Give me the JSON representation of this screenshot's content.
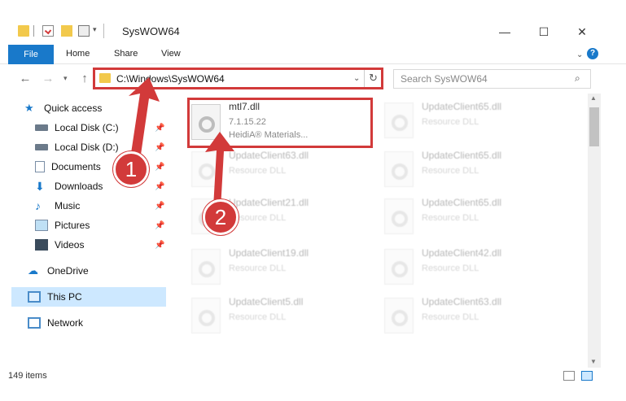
{
  "window": {
    "title": "SysWOW64",
    "minimize": "—",
    "maximize": "☐",
    "close": "✕"
  },
  "ribbon": {
    "tabs": [
      "File",
      "Home",
      "Share",
      "View"
    ],
    "help": "?"
  },
  "address": {
    "path": "C:\\Windows\\SysWOW64",
    "search_placeholder": "Search SysWOW64"
  },
  "sidebar": {
    "items": [
      {
        "label": "Quick access",
        "icon": "star-icon",
        "pinned": false
      },
      {
        "label": "Local Disk (C:)",
        "icon": "drive-icon",
        "pinned": true
      },
      {
        "label": "Local Disk (D:)",
        "icon": "drive-icon",
        "pinned": true
      },
      {
        "label": "Documents",
        "icon": "documents-icon",
        "pinned": true
      },
      {
        "label": "Downloads",
        "icon": "downloads-icon",
        "pinned": true
      },
      {
        "label": "Music",
        "icon": "music-icon",
        "pinned": true
      },
      {
        "label": "Pictures",
        "icon": "pictures-icon",
        "pinned": true
      },
      {
        "label": "Videos",
        "icon": "videos-icon",
        "pinned": true
      },
      {
        "label": "OneDrive",
        "icon": "cloud-icon",
        "pinned": false
      },
      {
        "label": "This PC",
        "icon": "computer-icon",
        "pinned": false
      },
      {
        "label": "Network",
        "icon": "network-icon",
        "pinned": false
      }
    ]
  },
  "files": {
    "highlighted": {
      "name": "mtl7.dll",
      "version": "7.1.15.22",
      "company": "HeidiA® Materials..."
    },
    "left_col": [
      {
        "name": "UpdateClient63.dll",
        "type": "Resource DLL"
      },
      {
        "name": "UpdateClient21.dll",
        "type": "Resource DLL"
      },
      {
        "name": "UpdateClient19.dll",
        "type": "Resource DLL"
      },
      {
        "name": "UpdateClient5.dll",
        "type": "Resource DLL"
      }
    ],
    "right_col": [
      {
        "name": "UpdateClient65.dll",
        "type": "Resource DLL"
      },
      {
        "name": "UpdateClient65.dll",
        "type": "Resource DLL"
      },
      {
        "name": "UpdateClient65.dll",
        "type": "Resource DLL"
      },
      {
        "name": "UpdateClient42.dll",
        "type": "Resource DLL"
      },
      {
        "name": "UpdateClient63.dll",
        "type": "Resource DLL"
      }
    ]
  },
  "status": {
    "count": "149 items"
  },
  "callouts": [
    "1",
    "2"
  ],
  "colors": {
    "accent": "#1979ca",
    "highlight": "#d23a3a",
    "selection": "#cde8ff"
  }
}
